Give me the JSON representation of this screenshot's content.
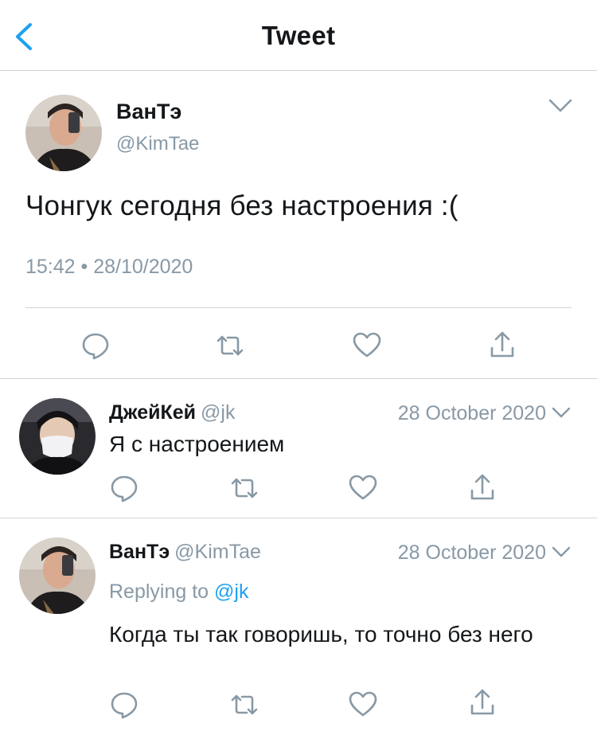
{
  "header": {
    "title": "Tweet"
  },
  "main_tweet": {
    "name": "ВанТэ",
    "handle": "@KimTae",
    "text": "Чонгук сегодня без настроения :(",
    "timestamp": "15:42 • 28/10/2020"
  },
  "replies": [
    {
      "name": "ДжейКей",
      "handle": "@jk",
      "date": "28 October 2020",
      "text": "Я с настроением"
    },
    {
      "name": "ВанТэ",
      "handle": "@KimTae",
      "date": "28 October 2020",
      "replying_prefix": "Replying to",
      "replying_to": "@jk",
      "text": "Когда ты так говоришь, то точно без него"
    }
  ],
  "colors": {
    "accent": "#1da1f2",
    "muted": "#8899a6",
    "divider": "#d0d4d9",
    "text": "#14171a"
  },
  "icons": [
    "back-chevron-icon",
    "chevron-down-icon",
    "reply-icon",
    "retweet-icon",
    "like-icon",
    "share-icon"
  ]
}
